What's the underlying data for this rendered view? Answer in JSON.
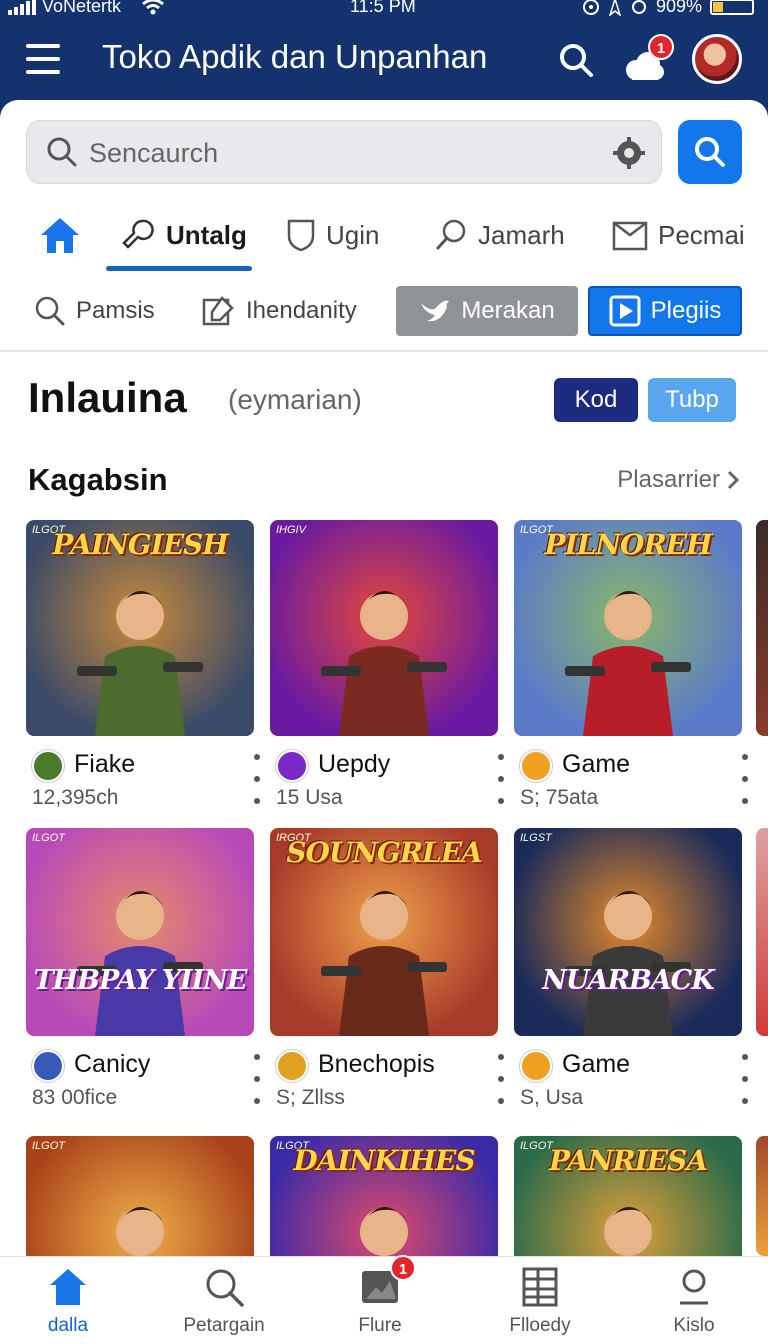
{
  "status_bar": {
    "carrier": "VoNetertk",
    "time": "11:5 PM",
    "battery": "909%"
  },
  "header": {
    "title": "Toko Apdik dan Unpanhan",
    "notification_count": "1"
  },
  "search": {
    "placeholder": "Sencaurch"
  },
  "tabs": [
    {
      "label": "Untalg",
      "icon": "wrench-icon",
      "active": true
    },
    {
      "label": "Ugin",
      "icon": "shield-icon",
      "active": false
    },
    {
      "label": "Jamarh",
      "icon": "magnifier-icon",
      "active": false
    },
    {
      "label": "Pecmai",
      "icon": "mail-icon",
      "active": false
    }
  ],
  "chips": [
    {
      "label": "Pamsis",
      "icon": "search-icon"
    },
    {
      "label": "Ihendanity",
      "icon": "edit-icon"
    },
    {
      "label": "Merakan",
      "icon": "bird-icon"
    },
    {
      "label": "Plegiis",
      "icon": "play-icon"
    }
  ],
  "section": {
    "title": "Inlauina",
    "subtitle": "(eymarian)",
    "pill_dark": "Kod",
    "pill_light": "Tubp"
  },
  "row": {
    "title": "Kagabsin",
    "link": "Plasarrier"
  },
  "cards": [
    {
      "thumb_title": "PAINGIESH",
      "tag": "ILGOT",
      "name": "Fiake",
      "sub": "12,395ch",
      "icon": "avatar-icon",
      "icon_color": "#4a7a2a",
      "bg1": "#3a4a68",
      "bg2": "#c98a3a",
      "fig": "#4d6b2e"
    },
    {
      "thumb_title": "",
      "tag": "IHGIV",
      "name": "Uepdy",
      "sub": "15 Usa",
      "icon": "purple-orb-icon",
      "icon_color": "#7a28c8",
      "bg1": "#6a1aa0",
      "bg2": "#e5483a",
      "fig": "#7a2a20"
    },
    {
      "thumb_title": "PILNOREH",
      "tag": "ILGOT",
      "name": "Game",
      "sub": "S; 75ata",
      "icon": "star-icon",
      "icon_color": "#f0a020",
      "bg1": "#5a7ac8",
      "bg2": "#8ab86a",
      "fig": "#b81e2a"
    },
    {
      "thumb_title": "THBPAY YIINE",
      "tag": "ILGOT",
      "name": "Canicy",
      "sub": "83 00fice",
      "icon": "globe-icon",
      "icon_color": "#3a5ab8",
      "bg1": "#b84ab8",
      "bg2": "#e58a6a",
      "fig": "#4a3aa8"
    },
    {
      "thumb_title": "SOUNGRLEA",
      "tag": "IRGOT",
      "name": "Bnechopis",
      "sub": "S; Zllss",
      "icon": "badge-star-icon",
      "icon_color": "#e0a020",
      "bg1": "#a83a2a",
      "bg2": "#f0a04a",
      "fig": "#6a2a1a"
    },
    {
      "thumb_title": "NUARBACK",
      "tag": "ILGST",
      "name": "Game",
      "sub": "S, Usa",
      "icon": "heart-icon",
      "icon_color": "#f0a020",
      "bg1": "#1a2a5a",
      "bg2": "#e58a2a",
      "fig": "#3a3a3a"
    },
    {
      "thumb_title": "",
      "tag": "ILGOT",
      "name": "",
      "sub": "",
      "icon": "",
      "icon_color": "#000",
      "bg1": "#a8421a",
      "bg2": "#f0b04a",
      "fig": "#4a2a1a"
    },
    {
      "thumb_title": "DAINKIHES",
      "tag": "ILGOT",
      "name": "",
      "sub": "",
      "icon": "",
      "icon_color": "#000",
      "bg1": "#3a2aa8",
      "bg2": "#e04a6a",
      "fig": "#2a7a9a"
    },
    {
      "thumb_title": "PANRIESA",
      "tag": "ILGOT",
      "name": "",
      "sub": "",
      "icon": "",
      "icon_color": "#000",
      "bg1": "#2a6a4a",
      "bg2": "#e0a03a",
      "fig": "#7a4a2a"
    }
  ],
  "bottom_nav": [
    {
      "label": "dalla",
      "icon": "home-icon",
      "active": true
    },
    {
      "label": "Petargain",
      "icon": "search-icon",
      "active": false
    },
    {
      "label": "Flure",
      "icon": "image-icon",
      "active": false,
      "badge": "1"
    },
    {
      "label": "Flloedy",
      "icon": "grid-icon",
      "active": false
    },
    {
      "label": "Kislo",
      "icon": "profile-icon",
      "active": false
    }
  ],
  "colors": {
    "header_bg": "#14336e",
    "accent": "#1376ea",
    "badge": "#e0262b"
  }
}
